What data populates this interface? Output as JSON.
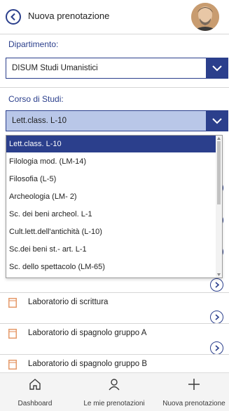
{
  "header": {
    "title": "Nuova prenotazione",
    "accent_color": "#2b3f8c"
  },
  "department": {
    "label": "Dipartimento:",
    "selected": "DISUM Studi Umanistici"
  },
  "course": {
    "label": "Corso di Studi:",
    "selected": "Lett.class. L-10",
    "options": [
      "Lett.class. L-10",
      "Filologia mod. (LM-14)",
      "Filosofia (L-5)",
      "Archeologia (LM- 2)",
      "Sc. dei beni archeol. L-1",
      "Cult.lett.dell'antichità (L-10)",
      "Sc.dei beni st.- art. L-1",
      "Sc. dello spettacolo (LM-65)"
    ]
  },
  "labs": {
    "items": [
      "Laboratorio di scrittura",
      "Laboratorio di spagnolo gruppo A",
      "Laboratorio di spagnolo gruppo B"
    ]
  },
  "bottom_nav": {
    "items": [
      {
        "label": "Dashboard",
        "icon": "home-icon"
      },
      {
        "label": "Le mie prenotazioni",
        "icon": "person-icon"
      },
      {
        "label": "Nuova prenotazione",
        "icon": "plus-icon"
      }
    ]
  }
}
